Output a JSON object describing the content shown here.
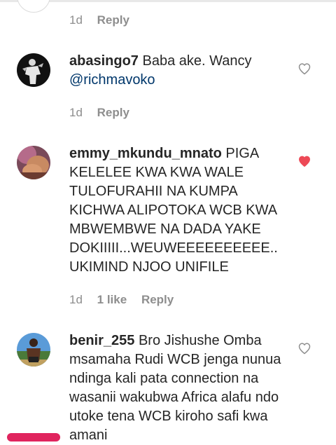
{
  "colors": {
    "text": "#262626",
    "meta": "#8e8e8e",
    "mention": "#00376b",
    "liked_heart": "#ed4956",
    "heart_outline": "#8e8e8e"
  },
  "top_comment": {
    "time": "1d",
    "reply_label": "Reply"
  },
  "comments": [
    {
      "username": "abasingo7",
      "text": "Baba ake. Wancy",
      "mention": "@richmavoko",
      "time": "1d",
      "likes": "",
      "reply_label": "Reply",
      "liked": false,
      "heart_icon": "heart-outline-icon"
    },
    {
      "username": "emmy_mkundu_mnato",
      "text": "PIGA KELELEE KWA KWA WALE TULOFURAHII NA KUMPA KICHWA ALIPOTOKA WCB KWA MBWEMBWE NA DADA YAKE DOKIIIII...WEUWEEEEEEEEEE.. UKIMIND NJOO UNIFILE",
      "time": "1d",
      "likes": "1 like",
      "reply_label": "Reply",
      "liked": true,
      "heart_icon": "heart-filled-icon"
    },
    {
      "username": "benir_255",
      "text": "Bro Jishushe Omba msamaha Rudi WCB jenga nunua ndinga kali pata connection na wasanii wakubwa Africa alafu ndo utoke tena WCB kiroho safi kwa amani",
      "time": "",
      "likes": "",
      "reply_label": "",
      "liked": false,
      "heart_icon": "heart-outline-icon"
    }
  ]
}
